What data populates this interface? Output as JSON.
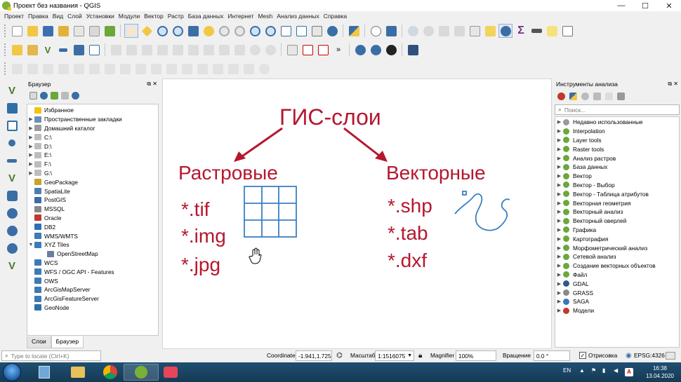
{
  "window": {
    "title": "Проект без названия - QGIS",
    "minimize": "—",
    "maximize": "☐",
    "close": "✕"
  },
  "menu": [
    "Проект",
    "Правка",
    "Вид",
    "Слой",
    "Установки",
    "Модули",
    "Вектор",
    "Растр",
    "База данных",
    "Интернет",
    "Mesh",
    "Анализ данных",
    "Справка"
  ],
  "browser": {
    "title": "Браузер",
    "items": [
      {
        "label": "Избранное",
        "icon": "star-icon",
        "color": "#f4c20d",
        "arrow": ""
      },
      {
        "label": "Пространственные закладки",
        "icon": "bookmark-icon",
        "color": "#6b8fb8",
        "arrow": "▶"
      },
      {
        "label": "Домашний каталог",
        "icon": "home-folder-icon",
        "color": "#9b9b9b",
        "arrow": "▶"
      },
      {
        "label": "C:\\",
        "icon": "drive-icon",
        "color": "#bdbdbd",
        "arrow": "▶"
      },
      {
        "label": "D:\\",
        "icon": "drive-icon",
        "color": "#bdbdbd",
        "arrow": "▶"
      },
      {
        "label": "E:\\",
        "icon": "drive-icon",
        "color": "#bdbdbd",
        "arrow": "▶"
      },
      {
        "label": "F:\\",
        "icon": "drive-icon",
        "color": "#bdbdbd",
        "arrow": "▶"
      },
      {
        "label": "G:\\",
        "icon": "drive-icon",
        "color": "#bdbdbd",
        "arrow": "▶"
      },
      {
        "label": "GeoPackage",
        "icon": "geopackage-icon",
        "color": "#c9a227",
        "arrow": ""
      },
      {
        "label": "SpatiaLite",
        "icon": "spatialite-icon",
        "color": "#4a7fb5",
        "arrow": ""
      },
      {
        "label": "PostGIS",
        "icon": "postgis-icon",
        "color": "#3a6ea5",
        "arrow": ""
      },
      {
        "label": "MSSQL",
        "icon": "mssql-icon",
        "color": "#888888",
        "arrow": ""
      },
      {
        "label": "Oracle",
        "icon": "oracle-icon",
        "color": "#c0392b",
        "arrow": ""
      },
      {
        "label": "DB2",
        "icon": "db2-icon",
        "color": "#2e6fb5",
        "arrow": ""
      },
      {
        "label": "WMS/WMTS",
        "icon": "wms-globe-icon",
        "color": "#3d7ab8",
        "arrow": ""
      },
      {
        "label": "XYZ Tiles",
        "icon": "xyz-tiles-icon",
        "color": "#3d7ab8",
        "arrow": "▼"
      },
      {
        "label": "OpenStreetMap",
        "icon": "tile-icon",
        "color": "#6a7fa0",
        "arrow": "",
        "indent": true
      },
      {
        "label": "WCS",
        "icon": "wcs-globe-icon",
        "color": "#3d7ab8",
        "arrow": ""
      },
      {
        "label": "WFS / OGC API - Features",
        "icon": "wfs-globe-icon",
        "color": "#3d7ab8",
        "arrow": ""
      },
      {
        "label": "OWS",
        "icon": "ows-globe-icon",
        "color": "#3d7ab8",
        "arrow": ""
      },
      {
        "label": "ArcGisMapServer",
        "icon": "arcgis-map-icon",
        "color": "#3d7ab8",
        "arrow": ""
      },
      {
        "label": "ArcGisFeatureServer",
        "icon": "arcgis-feature-icon",
        "color": "#3d7ab8",
        "arrow": ""
      },
      {
        "label": "GeoNode",
        "icon": "geonode-icon",
        "color": "#2f6fa8",
        "arrow": ""
      }
    ],
    "tabs": [
      "Слои",
      "Браузер"
    ]
  },
  "canvas": {
    "title": "ГИС-слои",
    "raster_heading": "Растровые",
    "raster_items": [
      "*.tif",
      "*.img",
      "*.jpg"
    ],
    "vector_heading": "Векторные",
    "vector_items": [
      "*.shp",
      "*.tab",
      "*.dxf"
    ],
    "text_color": "#b5172e",
    "drawing_color": "#3a7fc2"
  },
  "analysis": {
    "title": "Инструменты анализа",
    "search_placeholder": "Поиск...",
    "items": [
      {
        "label": "Недавно использованные",
        "icon": "clock-icon",
        "color": "#9a9a9a"
      },
      {
        "label": "Interpolation",
        "icon": "qgis-icon",
        "color": "#6aa83a"
      },
      {
        "label": "Layer tools",
        "icon": "qgis-icon",
        "color": "#6aa83a"
      },
      {
        "label": "Raster tools",
        "icon": "qgis-icon",
        "color": "#6aa83a"
      },
      {
        "label": "Анализ растров",
        "icon": "qgis-icon",
        "color": "#6aa83a"
      },
      {
        "label": "База данных",
        "icon": "qgis-icon",
        "color": "#6aa83a"
      },
      {
        "label": "Вектор",
        "icon": "qgis-icon",
        "color": "#6aa83a"
      },
      {
        "label": "Вектор - Выбор",
        "icon": "qgis-icon",
        "color": "#6aa83a"
      },
      {
        "label": "Вектор - Таблица атрибутов",
        "icon": "qgis-icon",
        "color": "#6aa83a"
      },
      {
        "label": "Векторная геометрия",
        "icon": "qgis-icon",
        "color": "#6aa83a"
      },
      {
        "label": "Векторный анализ",
        "icon": "qgis-icon",
        "color": "#6aa83a"
      },
      {
        "label": "Векторный оверлей",
        "icon": "qgis-icon",
        "color": "#6aa83a"
      },
      {
        "label": "Графика",
        "icon": "qgis-icon",
        "color": "#6aa83a"
      },
      {
        "label": "Картография",
        "icon": "qgis-icon",
        "color": "#6aa83a"
      },
      {
        "label": "Морфометрический анализ",
        "icon": "qgis-icon",
        "color": "#6aa83a"
      },
      {
        "label": "Сетевой анализ",
        "icon": "qgis-icon",
        "color": "#6aa83a"
      },
      {
        "label": "Создание векторных объектов",
        "icon": "qgis-icon",
        "color": "#6aa83a"
      },
      {
        "label": "Файл",
        "icon": "qgis-icon",
        "color": "#6aa83a"
      },
      {
        "label": "GDAL",
        "icon": "gdal-icon",
        "color": "#2c5a8a"
      },
      {
        "label": "GRASS",
        "icon": "grass-icon",
        "color": "#8a8a8a"
      },
      {
        "label": "SAGA",
        "icon": "saga-icon",
        "color": "#3a78b8"
      },
      {
        "label": "Модели",
        "icon": "models-icon",
        "color": "#c0392b"
      }
    ]
  },
  "status": {
    "locate_placeholder": "Type to locate (Ctrl+K)",
    "coordinate_label": "Coordinate",
    "coordinate_value": "-1.941,1.725",
    "scale_label": "Масштаб",
    "scale_value": "1:1516075",
    "magnifier_label": "Magnifier",
    "magnifier_value": "100%",
    "rotation_label": "Вращение",
    "rotation_value": "0.0 °",
    "render_label": "Отрисовка",
    "crs_label": "EPSG:4326"
  },
  "taskbar": {
    "lang": "EN",
    "time": "16:38",
    "date": "13.04.2020"
  }
}
